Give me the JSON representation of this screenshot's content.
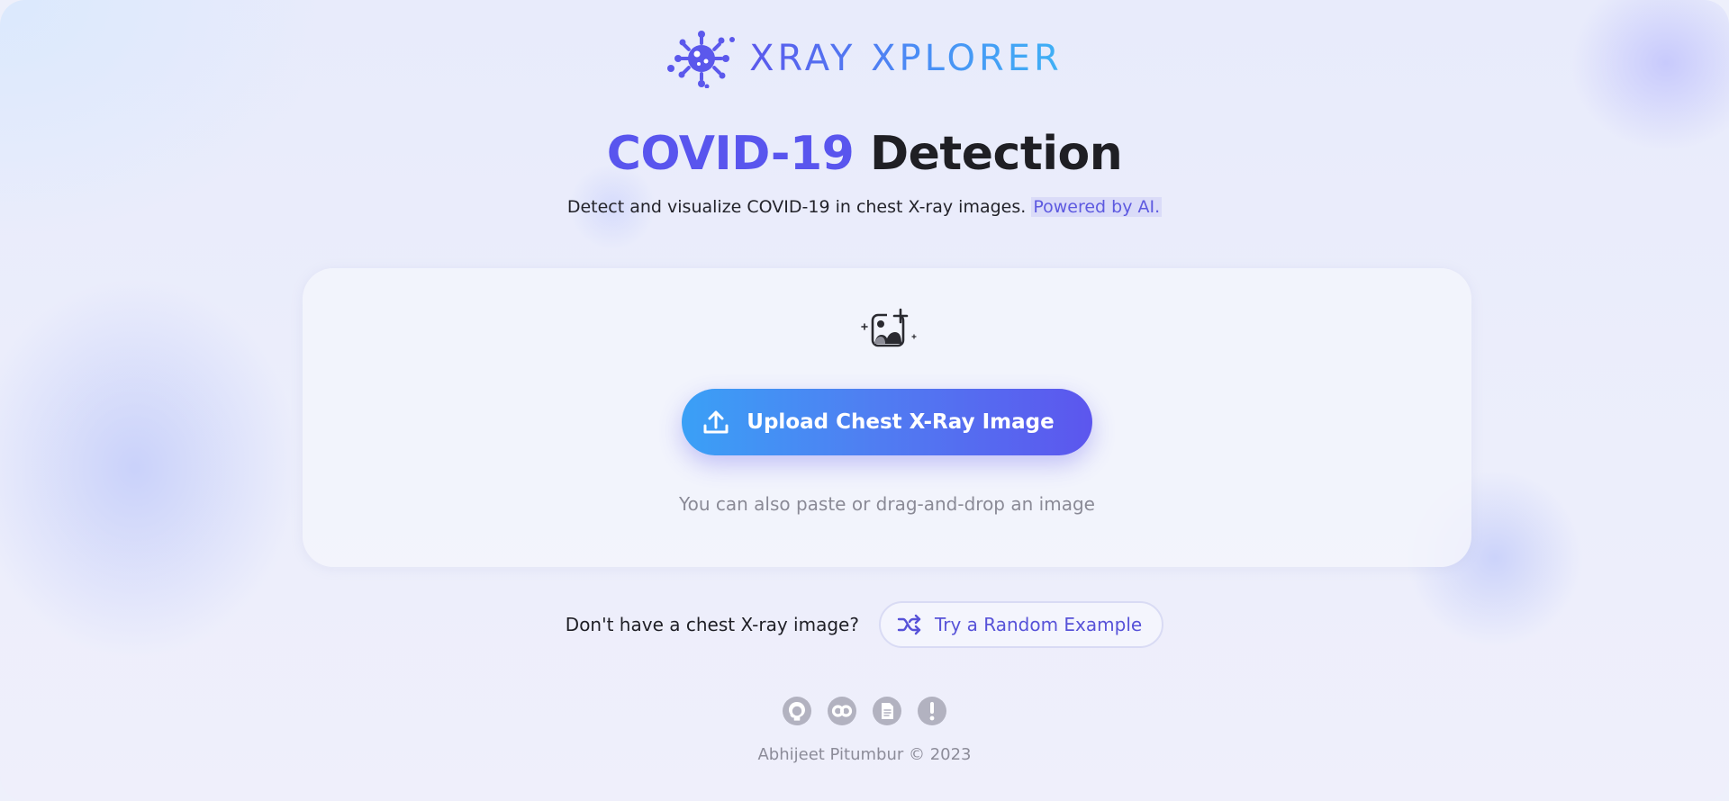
{
  "brand": {
    "name": "XRAY XPLORER",
    "logo_icon": "virus-icon",
    "gradient": [
      "#5b58ec",
      "#3fb1f5"
    ]
  },
  "hero": {
    "title_accent": "COVID-19",
    "title_rest": " Detection",
    "subtitle": "Detect and visualize COVID-19 in chest X-ray images. ",
    "subtitle_link": "Powered by AI."
  },
  "upload": {
    "icon": "add-image-icon",
    "button_label": "Upload Chest X-Ray Image",
    "button_icon": "upload-icon",
    "hint": "You can also paste or drag-and-drop an image"
  },
  "random_example": {
    "question": "Don't have a chest X-ray image?",
    "button_label": "Try a Random Example",
    "button_icon": "shuffle-icon"
  },
  "footer": {
    "links": [
      {
        "name": "github",
        "icon": "github-icon"
      },
      {
        "name": "colab",
        "icon": "colab-icon"
      },
      {
        "name": "document",
        "icon": "document-icon"
      },
      {
        "name": "alert",
        "icon": "alert-icon"
      }
    ],
    "copyright": "Abhijeet Pitumbur © 2023"
  },
  "colors": {
    "accent": "#5955ee",
    "text": "#1f1f24",
    "muted": "#8a8a96",
    "icon_gray": "#b2b2c0"
  }
}
